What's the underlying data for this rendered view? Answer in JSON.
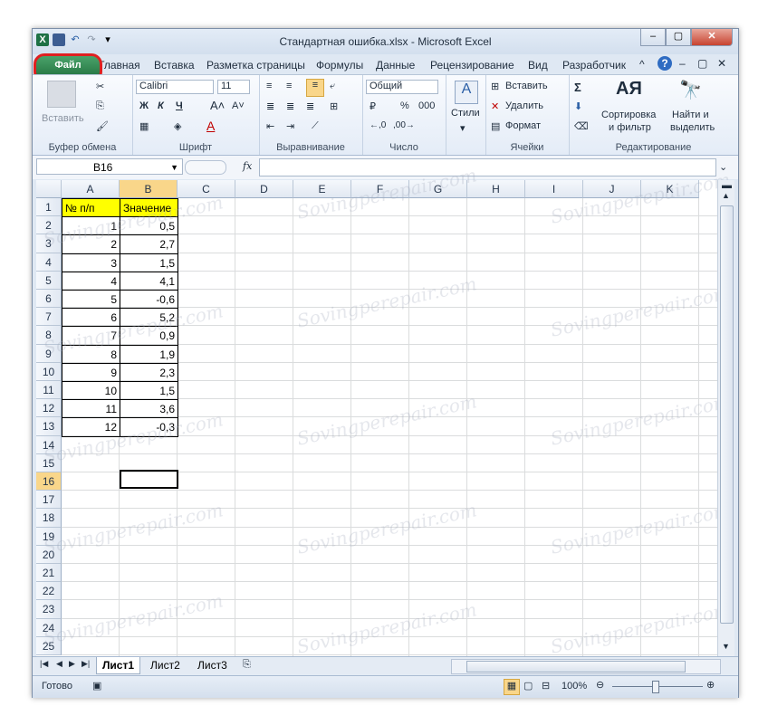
{
  "window": {
    "title": "Стандартная ошибка.xlsx - Microsoft Excel",
    "min": "–",
    "max": "▢",
    "close": "✕"
  },
  "tabs": [
    "Файл",
    "Главная",
    "Вставка",
    "Разметка страницы",
    "Формулы",
    "Данные",
    "Рецензирование",
    "Вид",
    "Разработчик"
  ],
  "ribbon": {
    "clipboard": {
      "paste": "Вставить",
      "label": "Буфер обмена"
    },
    "font": {
      "name": "Calibri",
      "size": "11",
      "bold": "Ж",
      "italic": "К",
      "underline": "Ч",
      "label": "Шрифт"
    },
    "alignment": {
      "label": "Выравнивание"
    },
    "number": {
      "format": "Общий",
      "percent": "%",
      "thousands": "000",
      "label": "Число"
    },
    "styles": {
      "label": "Стили"
    },
    "cells": {
      "insert": "Вставить",
      "delete": "Удалить",
      "format": "Формат",
      "label": "Ячейки"
    },
    "editing": {
      "sort1": "Сортировка",
      "sort2": "и фильтр",
      "find1": "Найти и",
      "find2": "выделить",
      "label": "Редактирование"
    }
  },
  "formula_bar": {
    "name_box": "B16",
    "fx": "fx",
    "formula": ""
  },
  "columns": [
    "A",
    "B",
    "C",
    "D",
    "E",
    "F",
    "G",
    "H",
    "I",
    "J",
    "K"
  ],
  "rows": [
    "1",
    "2",
    "3",
    "4",
    "5",
    "6",
    "7",
    "8",
    "9",
    "10",
    "11",
    "12",
    "13",
    "14",
    "15",
    "16",
    "17",
    "18",
    "19",
    "20",
    "21",
    "22",
    "23",
    "24",
    "25"
  ],
  "table": {
    "header_a": "№ п/п",
    "header_b": "Значение",
    "a": [
      "1",
      "2",
      "3",
      "4",
      "5",
      "6",
      "7",
      "8",
      "9",
      "10",
      "11",
      "12"
    ],
    "b": [
      "0,5",
      "2,7",
      "1,5",
      "4,1",
      "-0,6",
      "5,2",
      "0,9",
      "1,9",
      "2,3",
      "1,5",
      "3,6",
      "-0,3"
    ]
  },
  "sheets": [
    "Лист1",
    "Лист2",
    "Лист3"
  ],
  "status": {
    "ready": "Готово",
    "zoom": "100%"
  },
  "watermark": "Sovingperepair.com"
}
